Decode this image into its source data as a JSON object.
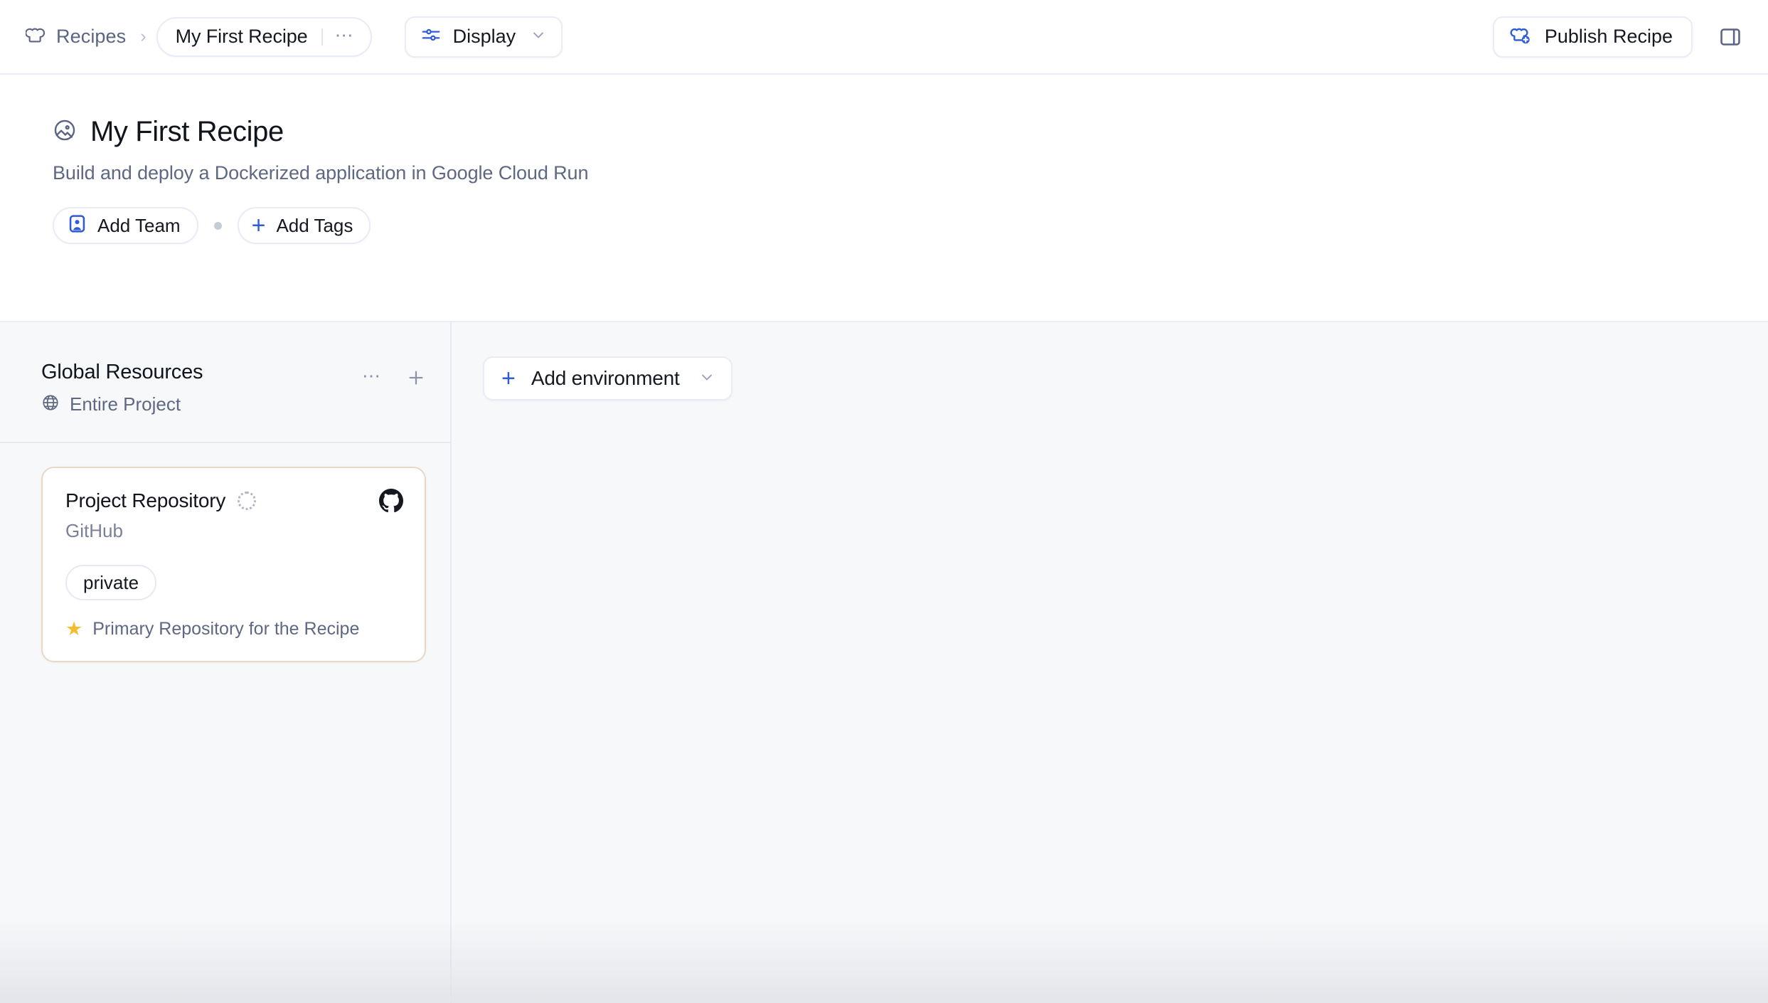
{
  "topbar": {
    "breadcrumb": {
      "root_icon": "chef-hat-icon",
      "root_label": "Recipes",
      "separator": "›",
      "current_label": "My First Recipe",
      "overflow_label": "…"
    },
    "display_button": {
      "icon": "sliders-icon",
      "label": "Display",
      "chevron": "chevron-down-icon"
    },
    "publish_button": {
      "icon": "publish-recipe-icon",
      "label": "Publish Recipe"
    },
    "panel_toggle": {
      "icon": "right-panel-toggle-icon"
    }
  },
  "hero": {
    "icon": "image-circle-icon",
    "title": "My First Recipe",
    "subtitle": "Build and deploy a Dockerized application in Google Cloud Run",
    "add_team": {
      "icon": "team-avatar-icon",
      "label": "Add Team"
    },
    "add_tags": {
      "icon": "plus-icon",
      "plus": "+",
      "label": "Add Tags"
    }
  },
  "sidepanel": {
    "title": "Global Resources",
    "scope_icon": "globe-icon",
    "scope_label": "Entire Project",
    "more_label": "•••",
    "add_label": "+",
    "resources": [
      {
        "name": "Project Repository",
        "status": "loading-spinner",
        "provider": "GitHub",
        "logo": "github-icon",
        "badge": "private",
        "primary_icon": "star-icon",
        "primary_label": "Primary Repository for the Recipe"
      }
    ]
  },
  "main": {
    "add_environment": {
      "plus": "+",
      "label": "Add environment",
      "chevron": "chevron-down-icon"
    }
  },
  "colors": {
    "accent_blue": "#2f5bd8",
    "text_primary": "#10141c",
    "text_muted": "#5f6883",
    "border": "#e9ebf6",
    "card_border": "#e7d9c6",
    "canvas": "#f7f8fa",
    "star_yellow": "#f5bd2e"
  }
}
